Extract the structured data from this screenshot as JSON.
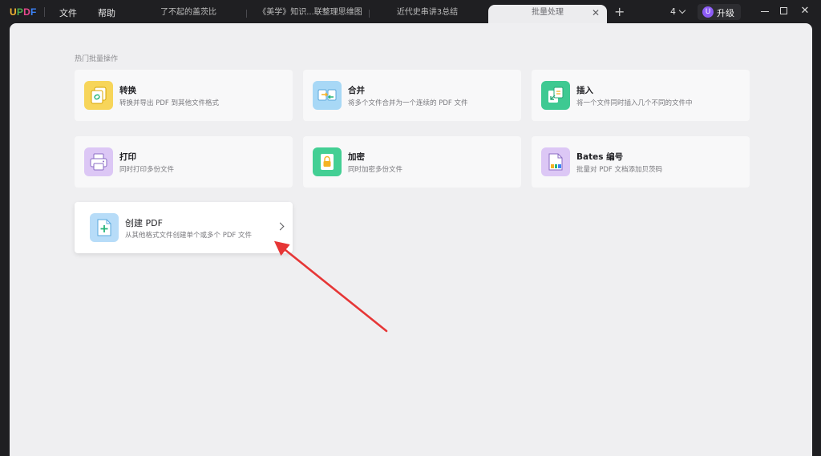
{
  "app": {
    "logo": "UPDF",
    "menu": {
      "file": "文件",
      "help": "帮助"
    },
    "tabs": [
      {
        "label": "了不起的盖茨比"
      },
      {
        "label": "《美学》知识...联整理思维图"
      },
      {
        "label": "近代史串讲3总结"
      },
      {
        "label": "批量处理",
        "active": true
      }
    ],
    "new_tab": "+",
    "counter": "4",
    "upgrade": {
      "avatar": "U",
      "label": "升级"
    },
    "window": {
      "close": "✕"
    },
    "colors": {
      "logo": [
        "#f7b733",
        "#4caf50",
        "#e84a8f",
        "#3b82f6"
      ]
    }
  },
  "main": {
    "section_title": "热门批量操作",
    "cards": [
      {
        "id": "convert",
        "title": "转换",
        "desc": "转换并导出 PDF 到其他文件格式",
        "icon": "convert-icon",
        "color": "#f7d55a"
      },
      {
        "id": "merge",
        "title": "合并",
        "desc": "将多个文件合并为一个连续的 PDF 文件",
        "icon": "merge-icon",
        "color": "#a8d8f6"
      },
      {
        "id": "insert",
        "title": "插入",
        "desc": "将一个文件同时插入几个不同的文件中",
        "icon": "insert-icon",
        "color": "#3ec992"
      },
      {
        "id": "print",
        "title": "打印",
        "desc": "同时打印多份文件",
        "icon": "print-icon",
        "color": "#dcc7f5"
      },
      {
        "id": "encrypt",
        "title": "加密",
        "desc": "同时加密多份文件",
        "icon": "lock-icon",
        "color": "#43cf94"
      },
      {
        "id": "bates",
        "title": "Bates 编号",
        "desc": "批量对 PDF 文档添加贝茨码",
        "icon": "bates-number-icon",
        "color": "#dcc7f5"
      },
      {
        "id": "create",
        "title": "创建 PDF",
        "desc": "从其他格式文件创建单个或多个 PDF 文件",
        "icon": "create-pdf-icon",
        "color": "#b7dcf8",
        "hovered": true
      }
    ]
  }
}
